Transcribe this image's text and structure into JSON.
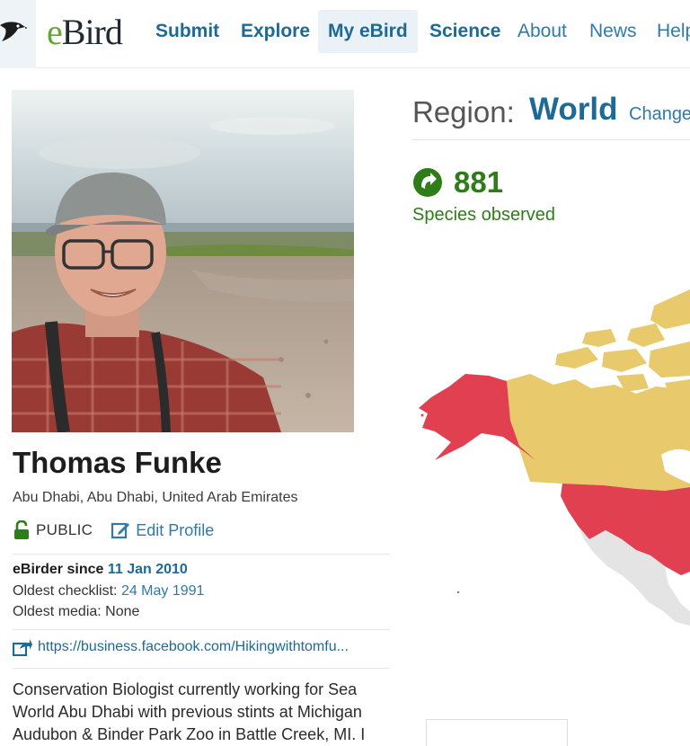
{
  "header": {
    "brand_e": "e",
    "brand_rest": "Bird",
    "nav": [
      {
        "label": "Submit",
        "bold": true,
        "active": false
      },
      {
        "label": "Explore",
        "bold": true,
        "active": false
      },
      {
        "label": "My eBird",
        "bold": true,
        "active": true
      },
      {
        "label": "Science",
        "bold": true,
        "active": false
      },
      {
        "label": "About",
        "bold": false,
        "active": false
      },
      {
        "label": "News",
        "bold": false,
        "active": false
      },
      {
        "label": "Help",
        "bold": false,
        "active": false
      }
    ]
  },
  "profile": {
    "name": "Thomas Funke",
    "location": "Abu Dhabi, Abu Dhabi, United Arab Emirates",
    "visibility": "PUBLIC",
    "edit_label": "Edit Profile",
    "since_label": "eBirder since",
    "since_value": "11 Jan 2010",
    "oldest_checklist_label": "Oldest checklist:",
    "oldest_checklist_value": "24 May 1991",
    "oldest_media_label": "Oldest media:",
    "oldest_media_value": "None",
    "website": "https://business.facebook.com/Hikingwithtomfu...",
    "bio": "Conservation Biologist currently working for Sea World Abu Dhabi with previous stints at Michigan Audubon & Binder Park Zoo in Battle Creek, MI. I"
  },
  "region": {
    "label": "Region:",
    "value": "World",
    "change_label": "Change",
    "species_count": "881",
    "species_label": "Species observed"
  },
  "colors": {
    "visited": "#e04050",
    "other": "#e8c96c",
    "none": "#e4e4e4",
    "brand_green": "#5fa833",
    "link_blue": "#1d6a96",
    "count_green": "#2e7d18"
  },
  "icons": [
    "bird-logo-icon",
    "unlock-icon",
    "edit-icon",
    "external-link-icon",
    "species-count-icon"
  ]
}
